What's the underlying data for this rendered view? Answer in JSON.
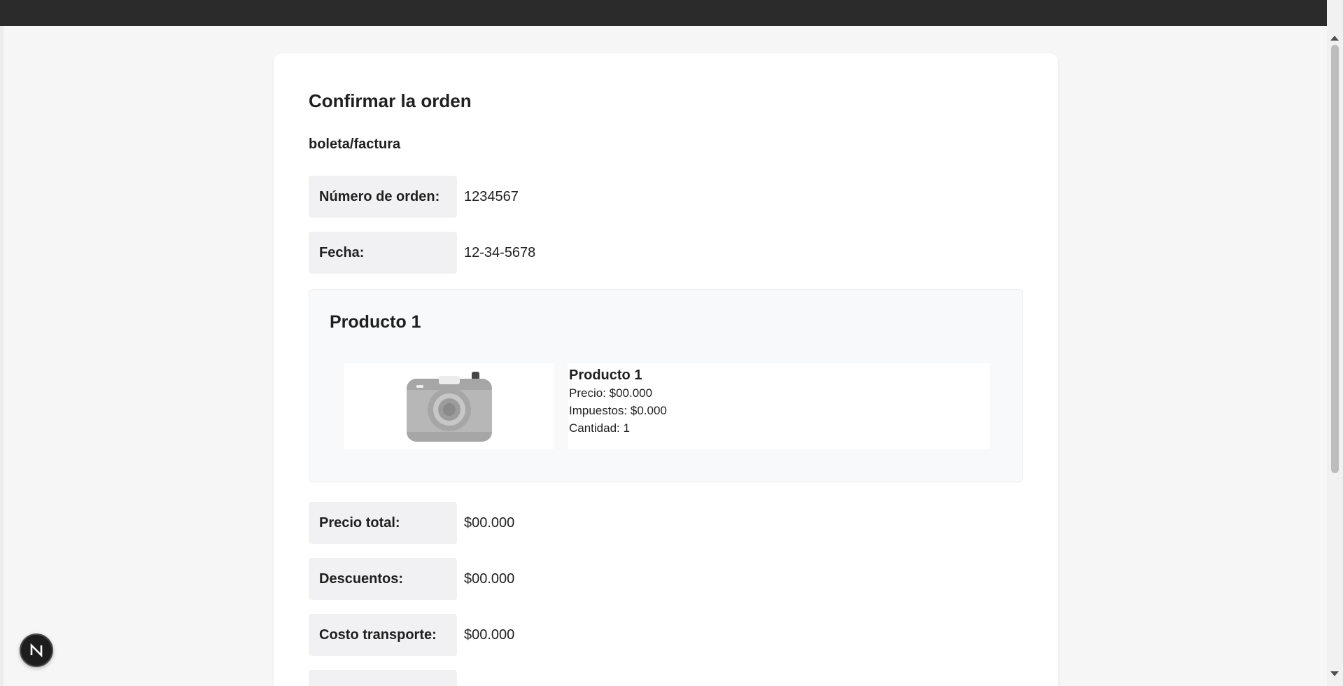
{
  "page": {
    "title": "Confirmar la orden",
    "subtitle": "boleta/factura"
  },
  "order": {
    "number_label": "Número de orden:",
    "number_value": "1234567",
    "date_label": "Fecha:",
    "date_value": "12-34-5678"
  },
  "products": [
    {
      "heading": "Producto 1",
      "image_icon": "camera-icon",
      "name": "Producto 1",
      "price": "Precio: $00.000",
      "taxes": "Impuestos: $0.000",
      "quantity": "Cantidad: 1"
    }
  ],
  "summary": {
    "total_label": "Precio total:",
    "total_value": "$00.000",
    "discount_label": "Descuentos:",
    "discount_value": "$00.000",
    "shipping_label": "Costo transporte:",
    "shipping_value": "$00.000"
  },
  "devtools": {
    "badge_icon": "nextjs-logo-icon",
    "badge_text": "N"
  },
  "colors": {
    "topbar": "#2b2b2b",
    "background": "#f6f6f6",
    "card": "#ffffff",
    "label_bg": "#f1f1f3",
    "product_box_bg": "#f8f9fa"
  }
}
